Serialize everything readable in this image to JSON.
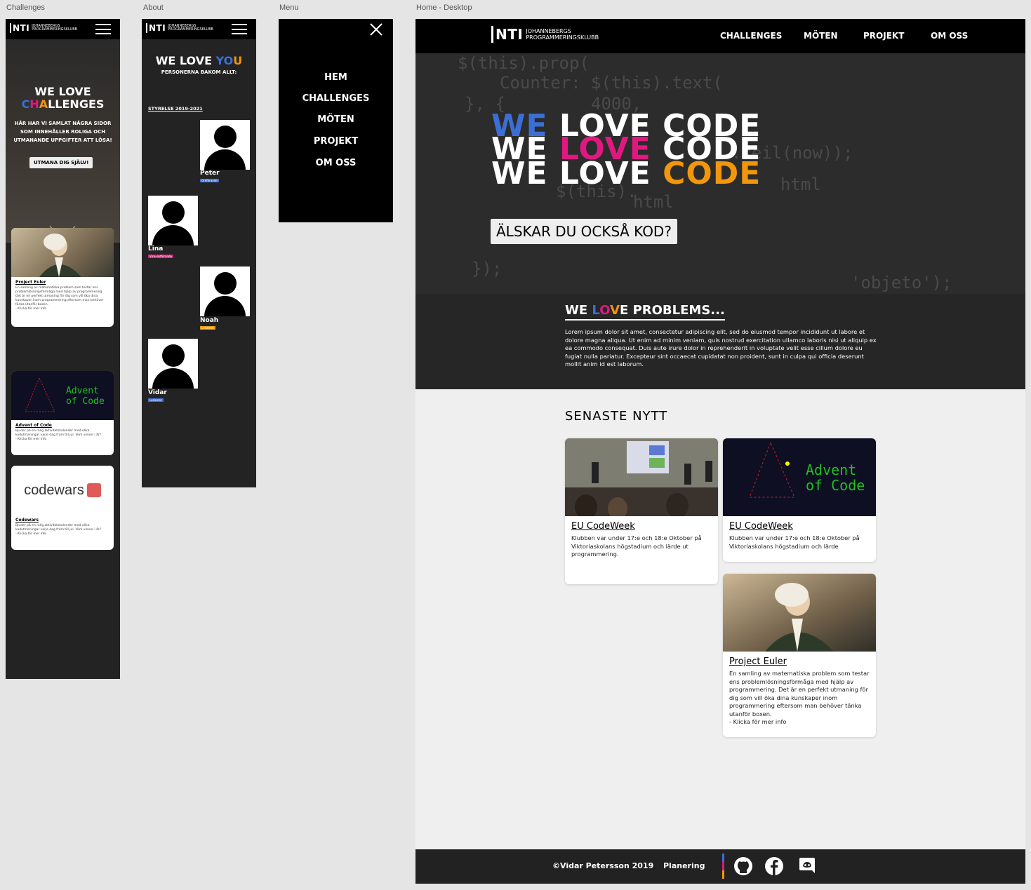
{
  "labels": {
    "challenges": "Challenges",
    "about": "About",
    "menu": "Menu",
    "desktop": "Home - Desktop"
  },
  "logo": {
    "nti": "NTI",
    "line1": "JOHANNEBERGS",
    "line2": "PROGRAMMERINGSKLUBB"
  },
  "challenges": {
    "title_line1": "WE LOVE",
    "title_c1": "C",
    "title_h": "H",
    "title_a": "A",
    "title_rest": "LLENGES",
    "text": "HÄR HAR VI SAMLAT NÅGRA SIDOR SOM INNEHÅLLER ROLIGA OCH UTMANANDE UPPGIFTER ATT LÖSA!",
    "button": "UTMANA DIG SJÄLV!",
    "cards": [
      {
        "title": "Project Euler",
        "desc": "En samling av matematiska problem som testar ens problemlösningsförmåga med hjälp av programmering. Det är en perfekt utmaning för dig som vill öka dina kunskaper inom programmering eftersom man behöver tänka utanför boxen.",
        "more": "- Klicka för mer info"
      },
      {
        "title": "Advent of Code",
        "desc": "Bjuder på en rolig aktivitetskalender med olika kodutmaningar varje dag fram till jul. Vem vinner i år?",
        "more": "- Klicka för mer info"
      },
      {
        "title": "Codewars",
        "desc": "Bjuder på en rolig aktivitetskalender med olika kodutmaningar varje dag fram till jul. Vem vinner i år?",
        "more": "- Klicka för mer info",
        "logo_text": "codewars"
      }
    ]
  },
  "about": {
    "title_a": "WE LOVE ",
    "title_b": "YO",
    "title_c": "U",
    "subtitle": "PERSONERNA BAKOM ALLT:",
    "board": "STYRELSE 2019-2021",
    "people": [
      {
        "name": "Peter",
        "role": "Ordförande",
        "color": "#3b6fd6"
      },
      {
        "name": "Lina",
        "role": "Vice-ordförande",
        "color": "#e0187f"
      },
      {
        "name": "Noah",
        "role": "Ledamot",
        "color": "#f2960c"
      },
      {
        "name": "Vidar",
        "role": "Ledamot",
        "color": "#3b6fd6"
      }
    ]
  },
  "menu": {
    "items": [
      "HEM",
      "CHALLENGES",
      "MÖTEN",
      "PROJEKT",
      "OM OSS"
    ]
  },
  "desktop": {
    "nav": [
      "CHALLENGES",
      "MÖTEN",
      "PROJEKT",
      "OM OSS"
    ],
    "hero": {
      "we": "WE",
      "love": "LOVE",
      "code": "CODE",
      "button": "ÄLSKAR DU OCKSÅ KOD?"
    },
    "problems": {
      "title_a": "WE ",
      "title_l": "L",
      "title_o": "O",
      "title_v": "V",
      "title_rest": "E PROBLEMS...",
      "text": "Lorem ipsum dolor sit amet, consectetur adipiscing elit, sed do eiusmod tempor incididunt ut labore et dolore magna aliqua. Ut enim ad minim veniam, quis nostrud exercitation ullamco laboris nisi ut aliquip ex ea commodo consequat. Duis aute irure dolor in reprehenderit in voluptate velit esse cillum dolore eu fugiat nulla pariatur. Excepteur sint occaecat cupidatat non proident, sunt in culpa qui officia deserunt mollit anim id est laborum."
    },
    "news_title": "SENASTE NYTT",
    "news": [
      {
        "title": "EU CodeWeek",
        "desc": "Klubben var under 17:e och 18:e Oktober på Viktoriaskolans högstadium och lärde ut programmering."
      },
      {
        "title": "EU CodeWeek",
        "desc": "Klubben var under 17:e och 18:e Oktober på Viktoriaskolans högstadium och lärde"
      },
      {
        "title": "Project Euler",
        "desc": "En samling av matematiska problem som testar ens problemlösningsförmåga med hjälp av programmering. Det är en perfekt utmaning för dig som vill öka dina kunskaper inom programmering eftersom man behöver tänka utanför boxen.",
        "more": "- Klicka för mer info"
      }
    ],
    "advent": {
      "line1": "Advent",
      "line2": "of Code"
    },
    "footer": {
      "copyright": "©Vidar Petersson 2019",
      "planering": "Planering"
    }
  },
  "colors": {
    "blue": "#3b6fd6",
    "pink": "#e0187f",
    "orange": "#f2960c",
    "green": "#22c322"
  }
}
